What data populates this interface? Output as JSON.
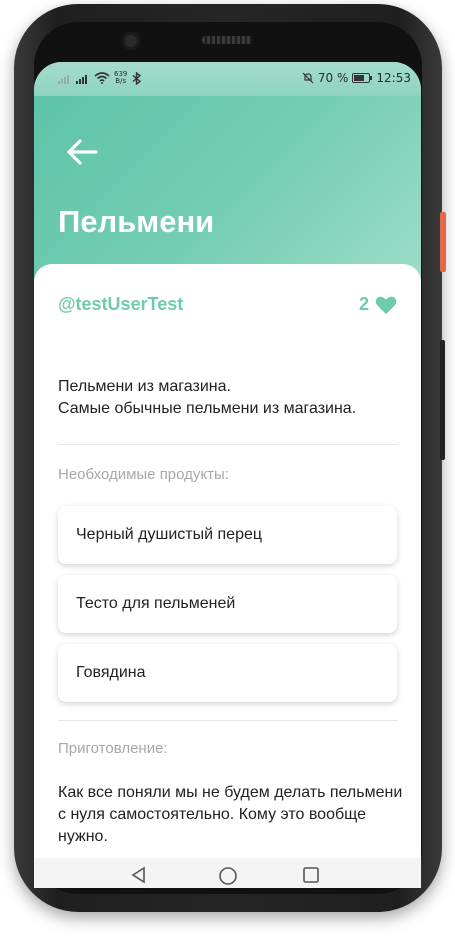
{
  "statusbar": {
    "speed_value": "639",
    "speed_unit": "B/s",
    "battery_percent": "70 %",
    "time": "12:53"
  },
  "recipe": {
    "title": "Пельмени",
    "author": "@testUserTest",
    "likes": "2",
    "description_line1": "Пельмени из магазина.",
    "description_line2": "Самые обычные пельмени из магазина.",
    "ingredients_label": "Необходимые продукты:",
    "ingredients": [
      "Черный душистый перец",
      "Тесто для пельменей",
      "Говядина"
    ],
    "preparation_label": "Приготовление:",
    "preparation_text": "Как все поняли мы не будем делать пельмени с нуля самостоятельно. Кому это вообще нужно."
  },
  "colors": {
    "accent": "#6fcbb0",
    "header_start": "#5cc2a5",
    "header_end": "#9ddcc8",
    "side_button": "#e0674a"
  },
  "icons": {
    "back": "arrow-left-icon",
    "like": "heart-icon",
    "nav_back": "triangle-back-icon",
    "nav_home": "circle-home-icon",
    "nav_recents": "square-recents-icon"
  }
}
